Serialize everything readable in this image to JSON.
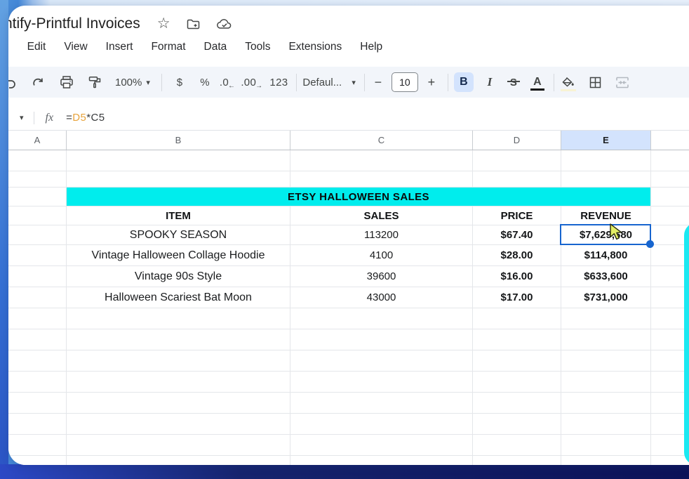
{
  "window": {
    "title": "ntify-Printful Invoices"
  },
  "menu": {
    "items": [
      "e",
      "Edit",
      "View",
      "Insert",
      "Format",
      "Data",
      "Tools",
      "Extensions",
      "Help"
    ]
  },
  "toolbar": {
    "zoom": "100%",
    "currency": "$",
    "percent": "%",
    "decrease_decimals": ".0",
    "increase_decimals": ".00",
    "more_formats": "123",
    "font_name": "Defaul...",
    "decrease_font": "−",
    "font_size": "10",
    "increase_font": "+",
    "bold": "B",
    "italic": "I",
    "strikethrough": "S",
    "text_color": "A"
  },
  "formula_bar": {
    "fx": "fx",
    "eq": "=",
    "ref1": "D5",
    "op": "*",
    "ref2": "C5"
  },
  "icons": {
    "star": "☆",
    "chevron_down": "▾",
    "arrow_left": "←",
    "arrow_right": "→"
  },
  "sheet": {
    "col_headers": [
      "A",
      "B",
      "C",
      "D",
      "E"
    ],
    "selected_column": "E",
    "banner": "ETSY HALLOWEEN SALES",
    "headers": [
      "ITEM",
      "SALES",
      "PRICE",
      "REVENUE"
    ],
    "rows": [
      [
        "SPOOKY SEASON",
        "113200",
        "$67.40",
        "$7,629,680"
      ],
      [
        "Vintage Halloween Collage Hoodie",
        "4100",
        "$28.00",
        "$114,800"
      ],
      [
        "Vintage 90s Style",
        "39600",
        "$16.00",
        "$633,600"
      ],
      [
        "Halloween Scariest Bat Moon",
        "43000",
        "$17.00",
        "$731,000"
      ]
    ]
  },
  "colors": {
    "banner_cyan": "#00eded",
    "selection_blue": "#1765cf",
    "selected_header_bg": "#d3e3fd",
    "widget_cyan": "#1be9f2"
  }
}
